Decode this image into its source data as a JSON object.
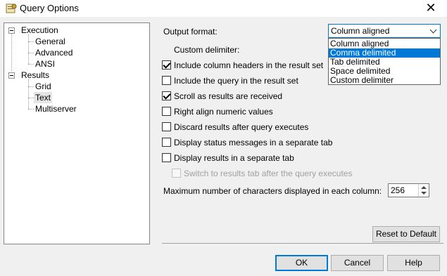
{
  "window": {
    "title": "Query Options",
    "close_glyph": "✕",
    "icon": "settings-window-icon"
  },
  "tree": {
    "execution": "Execution",
    "execution_children": [
      "General",
      "Advanced",
      "ANSI"
    ],
    "results": "Results",
    "results_children": [
      "Grid",
      "Text",
      "Multiserver"
    ],
    "selected": "Text"
  },
  "output_format": {
    "label": "Output format:",
    "value": "Column aligned",
    "options": [
      "Column aligned",
      "Comma delimited",
      "Tab delimited",
      "Space delimited",
      "Custom delimiter"
    ],
    "highlighted": "Comma delimited"
  },
  "custom_delimiter": {
    "label": "Custom delimiter:"
  },
  "checkboxes": [
    {
      "label": "Include column headers in the result set",
      "checked": true
    },
    {
      "label": "Include the query in the result set",
      "checked": false
    },
    {
      "label": "Scroll as results are received",
      "checked": true
    },
    {
      "label": "Right align numeric values",
      "checked": false
    },
    {
      "label": "Discard results after query executes",
      "checked": false
    },
    {
      "label": "Display status messages in a separate tab",
      "checked": false
    },
    {
      "label": "Display results in a separate tab",
      "checked": false
    },
    {
      "label": "Switch to results tab after the query executes",
      "checked": false,
      "disabled": true
    }
  ],
  "max_chars": {
    "label": "Maximum number of characters displayed in each column:",
    "value": "256"
  },
  "buttons": {
    "reset": "Reset to Default",
    "ok": "OK",
    "cancel": "Cancel",
    "help": "Help"
  },
  "colors": {
    "accent": "#0078d7",
    "selection": "#0078d7"
  }
}
